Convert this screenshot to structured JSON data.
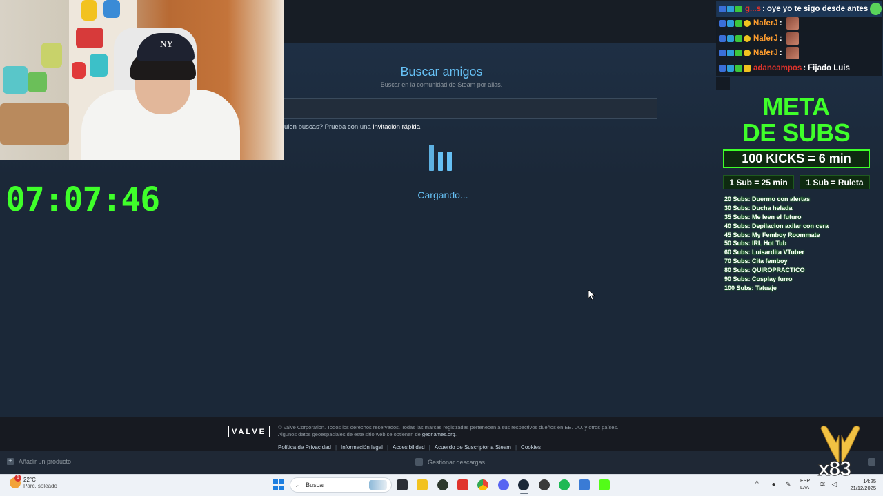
{
  "stream": {
    "timer": "07:07:46",
    "cap_logo": "NY"
  },
  "steam": {
    "find_friends": {
      "title": "Buscar amigos",
      "subtitle": "Buscar en la comunidad de Steam por alias.",
      "input_value": "",
      "invite_prefix": "uien buscas? Prueba con una ",
      "invite_link": "invitación rápida",
      "invite_suffix": ".",
      "loading_text": "Cargando..."
    },
    "footer": {
      "valve_logo": "VALVE",
      "legal_line_1": "© Valve Corporation. Todos los derechos reservados. Todas las marcas registradas pertenecen a sus respectivos dueños en EE. UU. y otros países.",
      "legal_line_2_prefix": "Algunos datos geoespaciales de este sitio web se obtienen de ",
      "legal_line_2_link": "geonames.org",
      "legal_line_2_suffix": ".",
      "links": [
        "Política de Privacidad",
        "Información legal",
        "Accesibilidad",
        "Acuerdo de Suscriptor a Steam",
        "Cookies"
      ]
    },
    "bottombar": {
      "add_product": "Añadir un producto",
      "manage_downloads": "Gestionar descargas"
    }
  },
  "chat": {
    "messages": [
      {
        "user": "g...s",
        "user_color": "#e0332b",
        "message": "oye yo te sigo desde antes",
        "emote": "green-face-emote"
      },
      {
        "user": "NaferJ",
        "user_color": "#ff9d2e",
        "message": "",
        "emote": "photo-emote"
      },
      {
        "user": "NaferJ",
        "user_color": "#ff9d2e",
        "message": "",
        "emote": "photo-emote"
      },
      {
        "user": "NaferJ",
        "user_color": "#ff9d2e",
        "message": "",
        "emote": "photo-emote"
      },
      {
        "user": "adancampos",
        "user_color": "#e0332b",
        "message": "Fijado Luis",
        "emote": ""
      }
    ]
  },
  "meta": {
    "title_line_1": "META",
    "title_line_2": "DE SUBS",
    "kicks": "100 KICKS = 6 min",
    "rule_1": "1 Sub = 25 min",
    "rule_2": "1 Sub = Ruleta",
    "goals": [
      "20 Subs: Duermo con alertas",
      "30 Subs: Ducha helada",
      "35 Subs: Me leen el futuro",
      "40 Subs: Depilacion axilar con cera",
      "45 Subs: My Femboy Roommate",
      "50 Subs: IRL Hot Tub",
      "60 Subs: Luisardita VTuber",
      "70 Subs: Cita femboy",
      "80 Subs: QUIROPRACTICO",
      "90 Subs: Cosplay furro",
      "100 Subs: Tatuaje"
    ],
    "accent_color": "#3fff2a"
  },
  "overlay": {
    "gift_count": "x83"
  },
  "taskbar": {
    "weather_temp": "22°C",
    "weather_desc": "Parc. soleado",
    "weather_badge": "1",
    "search_placeholder": "Buscar",
    "lang_line_1": "ESP",
    "lang_line_2": "LAA",
    "time": "14:25",
    "date": "21/12/2025",
    "apps": [
      "file-explorer-dark-icon",
      "folder-icon",
      "app-green-icon",
      "app-red-icon",
      "chrome-icon",
      "discord-icon",
      "steam-icon",
      "app-dark-icon",
      "spotify-icon",
      "notepad-icon",
      "kick-icon"
    ]
  }
}
